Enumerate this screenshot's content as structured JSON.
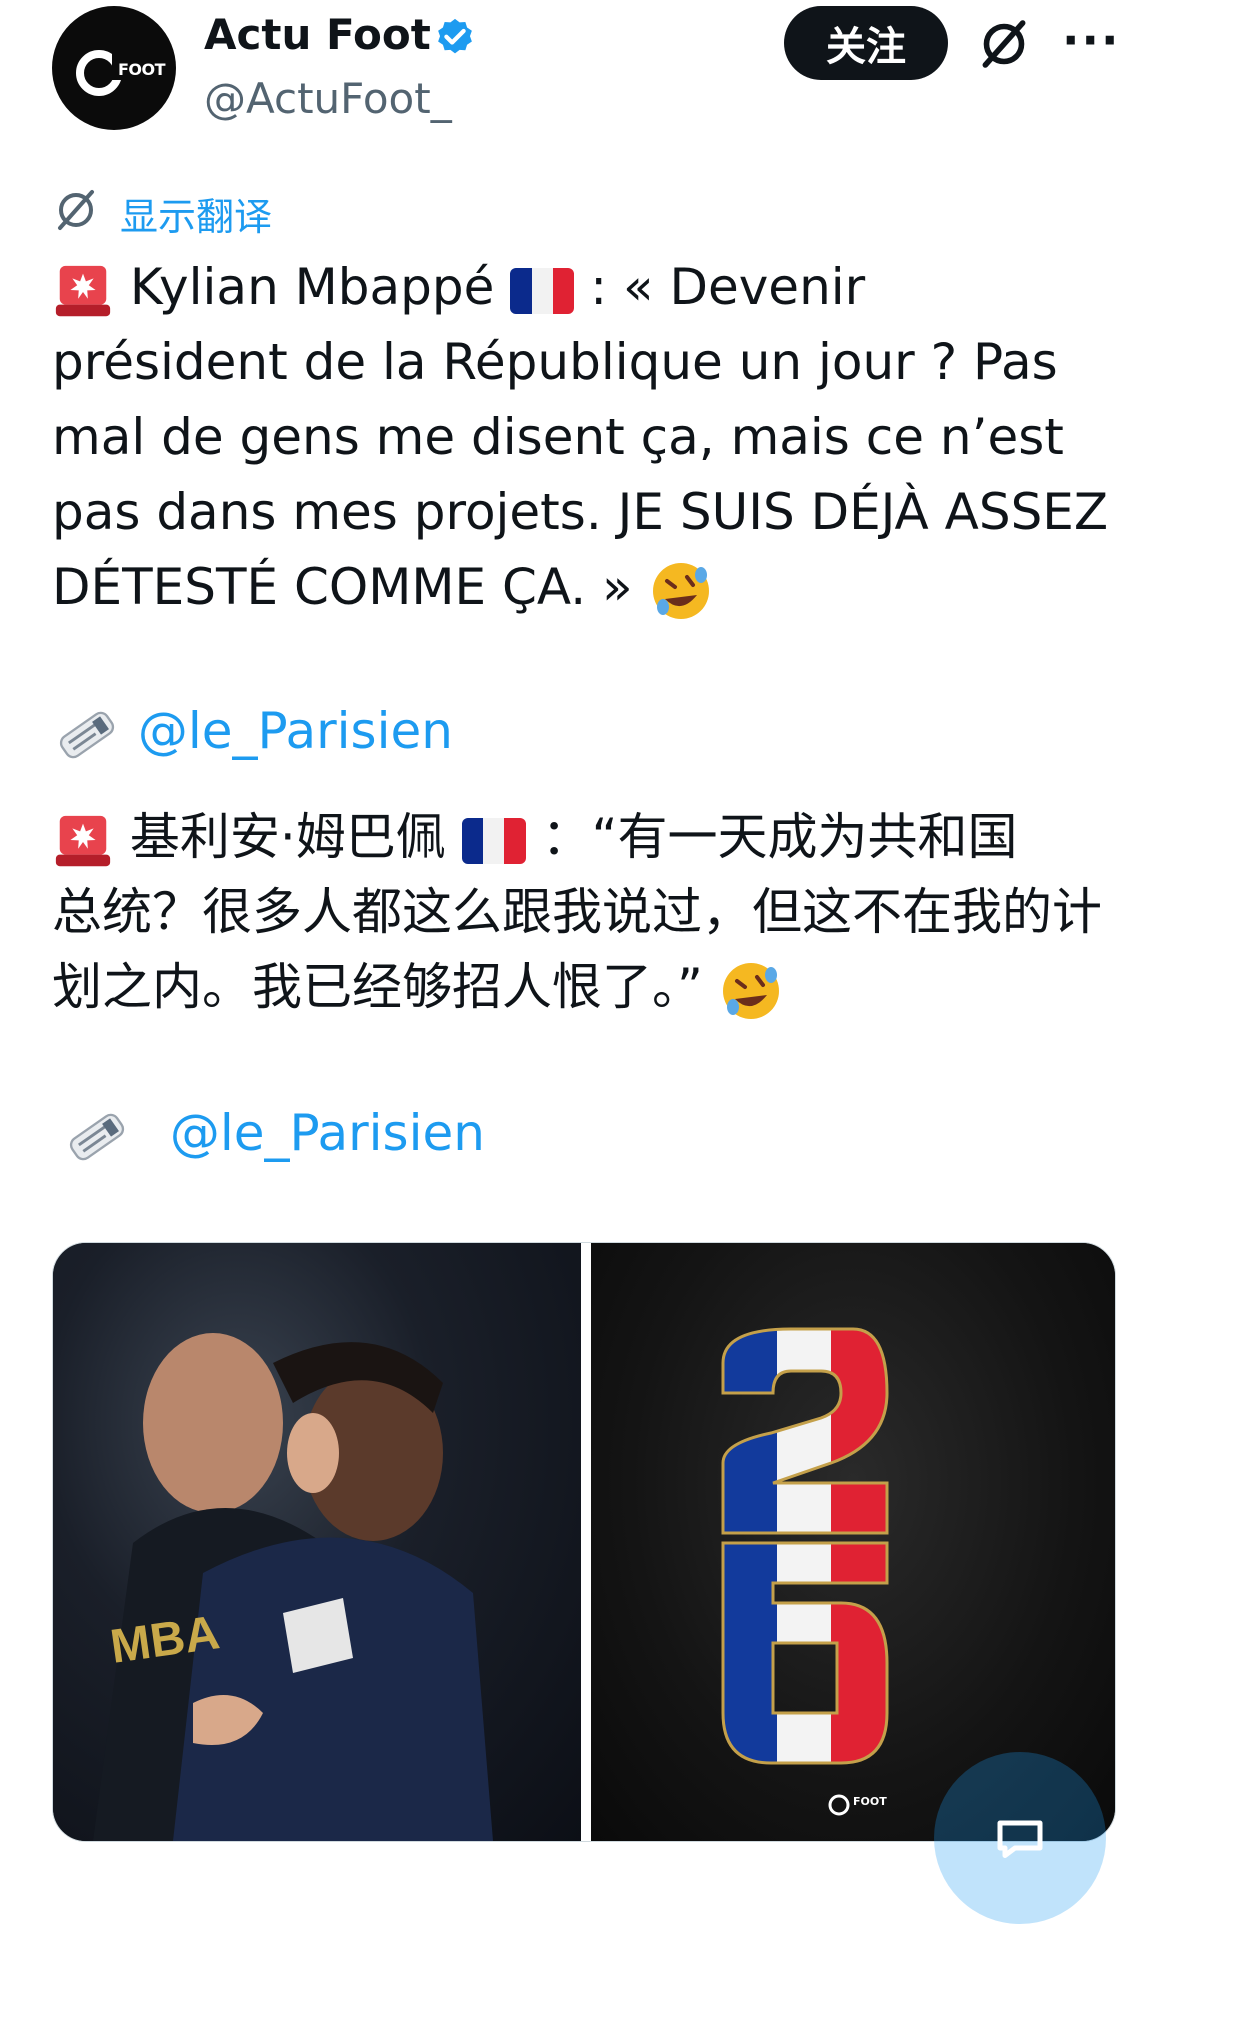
{
  "header": {
    "name": "Actu Foot",
    "handle": "@ActuFoot_",
    "follow_label": "关注",
    "avatar_text": "FOOT",
    "more_label": "···"
  },
  "translate": {
    "label": "显示翻译"
  },
  "tweet_fr": {
    "line1_a": "Kylian Mbappé",
    "line1_b": ": « Devenir président",
    "rest": "de la République un jour ? Pas mal de gens me disent ça, mais ce n’est pas dans mes projets. JE SUIS DÉJÀ ASSEZ DÉTESTÉ COMME ÇA. »",
    "source_mention": "@le_Parisien"
  },
  "tweet_zh": {
    "line1_a": "基利安·姆巴佩",
    "line1_b": "：“有一天成为共和国",
    "rest": "总统？很多人都这么跟我说过，但这不在我的计划之内。我已经够招人恨了。”",
    "source_mention": "@le_Parisien"
  },
  "media": {
    "left_image": "mbappe-macron-photo",
    "right_image": "france-flag-26-graphic",
    "right_logo_text": "FOOT"
  },
  "colors": {
    "accent": "#1d9bf0",
    "text": "#0f1419",
    "muted": "#536471",
    "flag_blue": "#0b2a8c",
    "flag_red": "#e02233"
  }
}
